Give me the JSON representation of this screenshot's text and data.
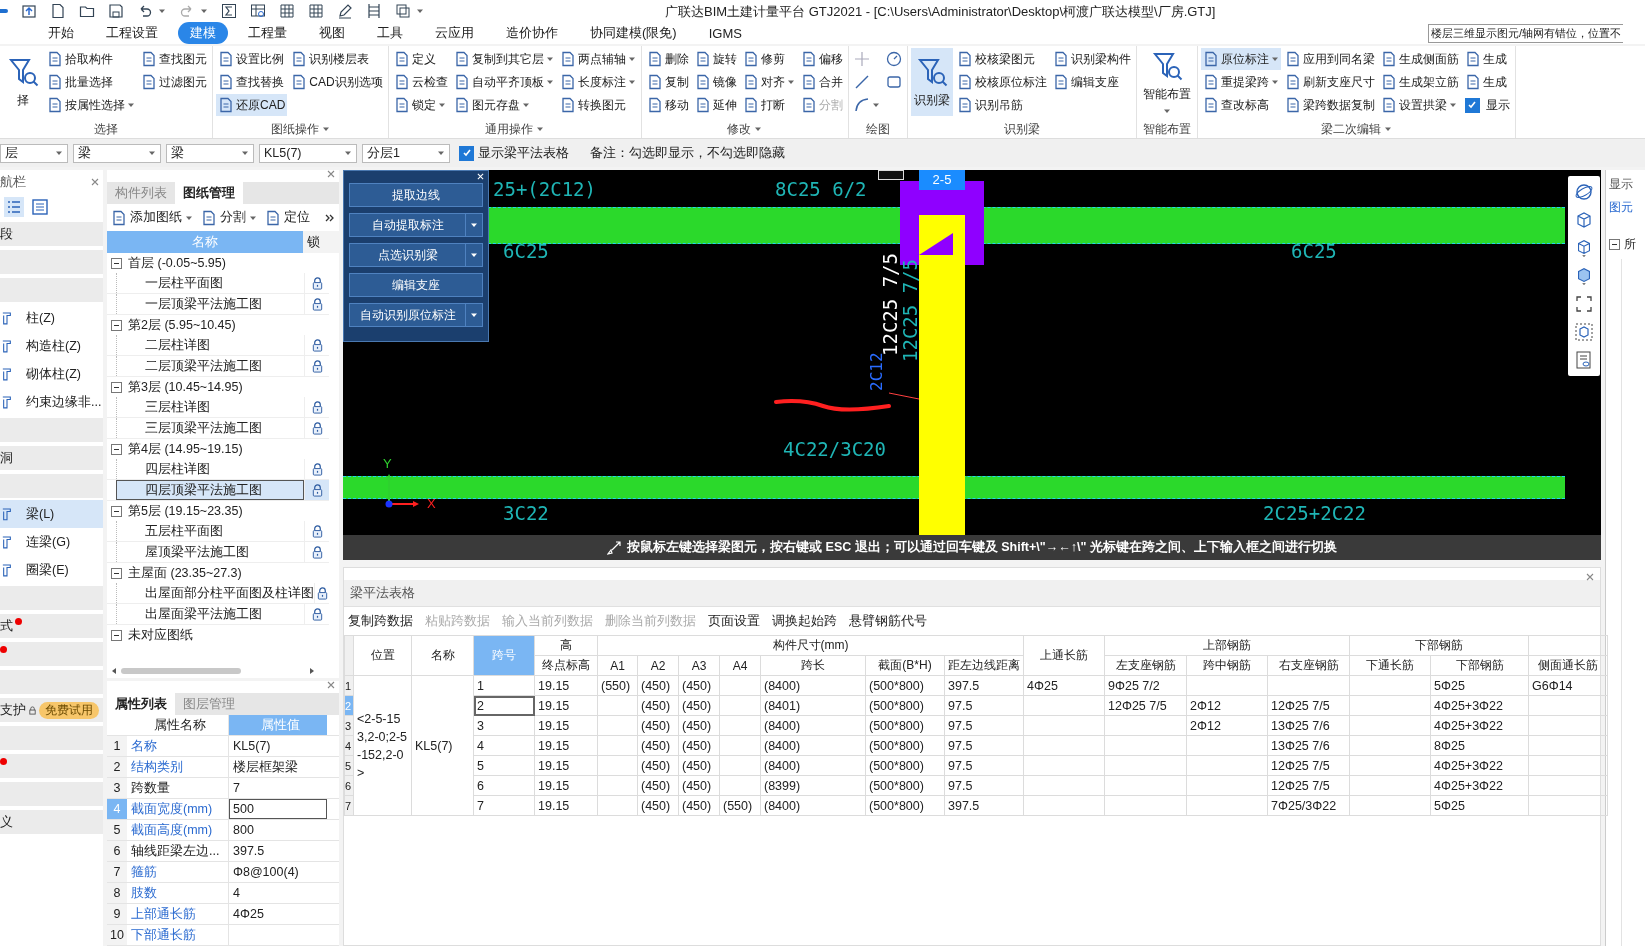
{
  "window": {
    "title": "广联达BIM土建计量平台 GTJ2021 - [C:\\Users\\Administrator\\Desktop\\柯渡广联达模型\\厂房.GTJ]"
  },
  "notice": "楼层三维显示图元/轴网有错位，位置不",
  "menu_tabs": [
    {
      "label": "开始",
      "selected": false
    },
    {
      "label": "工程设置",
      "selected": false
    },
    {
      "label": "建模",
      "selected": true
    },
    {
      "label": "工程量",
      "selected": false
    },
    {
      "label": "视图",
      "selected": false
    },
    {
      "label": "工具",
      "selected": false
    },
    {
      "label": "云应用",
      "selected": false
    },
    {
      "label": "造价协作",
      "selected": false
    },
    {
      "label": "协同建模(限免)",
      "selected": false
    },
    {
      "label": "IGMS",
      "selected": false
    }
  ],
  "ribbon_groups": [
    {
      "label": "选择",
      "menu": false,
      "columns": [
        [
          {
            "label": "择",
            "kind": "large",
            "selected": false,
            "disabled": false,
            "dropdown": false
          }
        ],
        [
          {
            "label": "拾取构件",
            "kind": "button",
            "selected": false,
            "disabled": false,
            "dropdown": false
          },
          {
            "label": "批量选择",
            "kind": "button",
            "selected": false,
            "disabled": false,
            "dropdown": false
          },
          {
            "label": "按属性选择",
            "kind": "button",
            "selected": false,
            "disabled": false,
            "dropdown": true
          }
        ],
        [
          {
            "label": "查找图元",
            "kind": "button",
            "selected": false,
            "disabled": false,
            "dropdown": false
          },
          {
            "label": "过滤图元",
            "kind": "button",
            "selected": false,
            "disabled": false,
            "dropdown": false
          }
        ]
      ]
    },
    {
      "label": "图纸操作",
      "menu": true,
      "columns": [
        [
          {
            "label": "设置比例",
            "kind": "button",
            "selected": false,
            "disabled": false,
            "dropdown": false
          },
          {
            "label": "查找替换",
            "kind": "button",
            "selected": false,
            "disabled": false,
            "dropdown": false
          },
          {
            "label": "还原CAD",
            "kind": "button",
            "selected": true,
            "disabled": false,
            "dropdown": false
          }
        ],
        [
          {
            "label": "识别楼层表",
            "kind": "button",
            "selected": false,
            "disabled": false,
            "dropdown": false
          },
          {
            "label": "CAD识别选项",
            "kind": "button",
            "selected": false,
            "disabled": false,
            "dropdown": false
          }
        ]
      ]
    },
    {
      "label": "通用操作",
      "menu": true,
      "columns": [
        [
          {
            "label": "定义",
            "kind": "button",
            "selected": false,
            "disabled": false,
            "dropdown": false
          },
          {
            "label": "云检查",
            "kind": "button",
            "selected": false,
            "disabled": false,
            "dropdown": false
          },
          {
            "label": "锁定",
            "kind": "button",
            "selected": false,
            "disabled": false,
            "dropdown": true
          }
        ],
        [
          {
            "label": "复制到其它层",
            "kind": "button",
            "selected": false,
            "disabled": false,
            "dropdown": true
          },
          {
            "label": "自动平齐顶板",
            "kind": "button",
            "selected": false,
            "disabled": false,
            "dropdown": true
          },
          {
            "label": "图元存盘",
            "kind": "button",
            "selected": false,
            "disabled": false,
            "dropdown": true
          }
        ],
        [
          {
            "label": "两点辅轴",
            "kind": "button",
            "selected": false,
            "disabled": false,
            "dropdown": true
          },
          {
            "label": "长度标注",
            "kind": "button",
            "selected": false,
            "disabled": false,
            "dropdown": true
          },
          {
            "label": "转换图元",
            "kind": "button",
            "selected": false,
            "disabled": false,
            "dropdown": false
          }
        ]
      ]
    },
    {
      "label": "修改",
      "menu": true,
      "columns": [
        [
          {
            "label": "删除",
            "kind": "button",
            "selected": false,
            "disabled": false,
            "dropdown": false
          },
          {
            "label": "复制",
            "kind": "button",
            "selected": false,
            "disabled": false,
            "dropdown": false
          },
          {
            "label": "移动",
            "kind": "button",
            "selected": false,
            "disabled": false,
            "dropdown": false
          }
        ],
        [
          {
            "label": "旋转",
            "kind": "button",
            "selected": false,
            "disabled": false,
            "dropdown": false
          },
          {
            "label": "镜像",
            "kind": "button",
            "selected": false,
            "disabled": false,
            "dropdown": false
          },
          {
            "label": "延伸",
            "kind": "button",
            "selected": false,
            "disabled": false,
            "dropdown": false
          }
        ],
        [
          {
            "label": "修剪",
            "kind": "button",
            "selected": false,
            "disabled": false,
            "dropdown": false
          },
          {
            "label": "对齐",
            "kind": "button",
            "selected": false,
            "disabled": false,
            "dropdown": true
          },
          {
            "label": "打断",
            "kind": "button",
            "selected": false,
            "disabled": false,
            "dropdown": false
          }
        ],
        [
          {
            "label": "偏移",
            "kind": "button",
            "selected": false,
            "disabled": false,
            "dropdown": false
          },
          {
            "label": "合并",
            "kind": "button",
            "selected": false,
            "disabled": false,
            "dropdown": false
          },
          {
            "label": "分割",
            "kind": "button",
            "selected": false,
            "disabled": true,
            "dropdown": false
          }
        ]
      ]
    },
    {
      "label": "绘图",
      "menu": false,
      "columns": [
        [
          {
            "kind": "icon",
            "selected": false,
            "disabled": false,
            "dropdown": false
          },
          {
            "kind": "icon",
            "selected": false,
            "disabled": false,
            "dropdown": false
          },
          {
            "kind": "icon",
            "selected": false,
            "disabled": false,
            "dropdown": true
          }
        ],
        [
          {
            "kind": "icon",
            "selected": false,
            "disabled": false,
            "dropdown": false
          },
          {
            "kind": "icon",
            "selected": false,
            "disabled": false,
            "dropdown": false
          }
        ]
      ]
    },
    {
      "label": "识别梁",
      "menu": false,
      "columns": [
        [
          {
            "label": "识别梁",
            "kind": "large",
            "selected": true,
            "disabled": false,
            "dropdown": false
          }
        ],
        [
          {
            "label": "校核梁图元",
            "kind": "button",
            "selected": false,
            "disabled": false,
            "dropdown": false
          },
          {
            "label": "校核原位标注",
            "kind": "button",
            "selected": false,
            "disabled": false,
            "dropdown": false
          },
          {
            "label": "识别吊筋",
            "kind": "button",
            "selected": false,
            "disabled": false,
            "dropdown": false
          }
        ],
        [
          {
            "label": "识别梁构件",
            "kind": "button",
            "selected": false,
            "disabled": false,
            "dropdown": false
          },
          {
            "label": "编辑支座",
            "kind": "button",
            "selected": false,
            "disabled": false,
            "dropdown": false
          }
        ]
      ]
    },
    {
      "label": "智能布置",
      "menu": false,
      "columns": [
        [
          {
            "label": "智能布置",
            "kind": "large",
            "selected": false,
            "disabled": false,
            "dropdown": true
          }
        ]
      ]
    },
    {
      "label": "梁二次编辑",
      "menu": true,
      "columns": [
        [
          {
            "label": "原位标注",
            "kind": "button",
            "selected": true,
            "disabled": false,
            "dropdown": true
          },
          {
            "label": "重提梁跨",
            "kind": "button",
            "selected": false,
            "disabled": false,
            "dropdown": true
          },
          {
            "label": "查改标高",
            "kind": "button",
            "selected": false,
            "disabled": false,
            "dropdown": false
          }
        ],
        [
          {
            "label": "应用到同名梁",
            "kind": "button",
            "selected": false,
            "disabled": false,
            "dropdown": false
          },
          {
            "label": "刷新支座尺寸",
            "kind": "button",
            "selected": false,
            "disabled": false,
            "dropdown": false
          },
          {
            "label": "梁跨数据复制",
            "kind": "button",
            "selected": false,
            "disabled": false,
            "dropdown": false
          }
        ],
        [
          {
            "label": "生成侧面筋",
            "kind": "button",
            "selected": false,
            "disabled": false,
            "dropdown": false
          },
          {
            "label": "生成架立筋",
            "kind": "button",
            "selected": false,
            "disabled": false,
            "dropdown": false
          },
          {
            "label": "设置拱梁",
            "kind": "button",
            "selected": false,
            "disabled": false,
            "dropdown": true
          }
        ],
        [
          {
            "label": "生成",
            "kind": "button",
            "selected": false,
            "disabled": false,
            "dropdown": false
          },
          {
            "label": "生成",
            "kind": "button",
            "selected": false,
            "disabled": false,
            "dropdown": false
          },
          {
            "label": "显示",
            "kind": "checkbox",
            "selected": false,
            "disabled": false,
            "dropdown": false,
            "checked": true
          }
        ]
      ]
    }
  ],
  "toolbar": {
    "selects": [
      "层",
      "梁",
      "梁",
      "KL5(7)",
      "分层1"
    ],
    "show_table": {
      "label": "显示梁平法表格",
      "checked": true
    },
    "note": "备注：勾选即显示，不勾选即隐藏"
  },
  "nav": {
    "title": "航栏",
    "items": [
      {
        "kind": "category",
        "label": "段"
      },
      {
        "kind": "category"
      },
      {
        "kind": "category"
      },
      {
        "kind": "item",
        "label": "柱(Z)",
        "selected": false
      },
      {
        "kind": "item",
        "label": "构造柱(Z)",
        "selected": false
      },
      {
        "kind": "item",
        "label": "砌体柱(Z)",
        "selected": false
      },
      {
        "kind": "item",
        "label": "约束边缘非...",
        "selected": false
      },
      {
        "kind": "category"
      },
      {
        "kind": "category",
        "label": "洞"
      },
      {
        "kind": "category"
      },
      {
        "kind": "item",
        "label": "梁(L)",
        "selected": true
      },
      {
        "kind": "item",
        "label": "连梁(G)",
        "selected": false
      },
      {
        "kind": "item",
        "label": "圈梁(E)",
        "selected": false
      },
      {
        "kind": "category"
      },
      {
        "kind": "category",
        "label": "式",
        "dot": true
      },
      {
        "kind": "category",
        "dot": true
      },
      {
        "kind": "category"
      },
      {
        "kind": "category",
        "label": "支护",
        "locked": true,
        "badge": "免费试用"
      },
      {
        "kind": "category"
      },
      {
        "kind": "category",
        "dot": true
      },
      {
        "kind": "category"
      },
      {
        "kind": "category",
        "label": "义"
      }
    ]
  },
  "drawing_panel": {
    "tabs": [
      {
        "label": "构件列表",
        "selected": false
      },
      {
        "label": "图纸管理",
        "selected": true
      }
    ],
    "actions": [
      {
        "label": "添加图纸",
        "dropdown": true
      },
      {
        "label": "分割",
        "dropdown": true
      },
      {
        "label": "定位",
        "dropdown": false
      }
    ],
    "columns": [
      "名称",
      "锁"
    ],
    "tree": [
      {
        "label": "首层 (-0.05~5.95)",
        "expanded": true,
        "children": [
          {
            "label": "一层柱平面图",
            "selected": false,
            "locked": true
          },
          {
            "label": "一层顶梁平法施工图",
            "selected": false,
            "locked": true
          }
        ]
      },
      {
        "label": "第2层 (5.95~10.45)",
        "expanded": true,
        "children": [
          {
            "label": "二层柱详图",
            "selected": false,
            "locked": true
          },
          {
            "label": "二层顶梁平法施工图",
            "selected": false,
            "locked": true
          }
        ]
      },
      {
        "label": "第3层 (10.45~14.95)",
        "expanded": true,
        "children": [
          {
            "label": "三层柱详图",
            "selected": false,
            "locked": true
          },
          {
            "label": "三层顶梁平法施工图",
            "selected": false,
            "locked": true
          }
        ]
      },
      {
        "label": "第4层 (14.95~19.15)",
        "expanded": true,
        "children": [
          {
            "label": "四层柱详图",
            "selected": false,
            "locked": true
          },
          {
            "label": "四层顶梁平法施工图",
            "selected": true,
            "locked": true
          }
        ]
      },
      {
        "label": "第5层 (19.15~23.35)",
        "expanded": true,
        "children": [
          {
            "label": "五层柱平面图",
            "selected": false,
            "locked": true
          },
          {
            "label": "屋顶梁平法施工图",
            "selected": false,
            "locked": true
          }
        ]
      },
      {
        "label": "主屋面 (23.35~27.3)",
        "expanded": true,
        "children": [
          {
            "label": "出屋面部分柱平面图及柱详图",
            "selected": false,
            "locked": true
          },
          {
            "label": "出屋面梁平法施工图",
            "selected": false,
            "locked": true
          }
        ]
      },
      {
        "label": "未对应图纸",
        "expanded": true
      }
    ]
  },
  "property_panel": {
    "tabs": [
      {
        "label": "属性列表",
        "selected": true
      },
      {
        "label": "图层管理",
        "selected": false
      }
    ],
    "columns": [
      "属性名称",
      "属性值"
    ],
    "rows": [
      {
        "index": "1",
        "name": "名称",
        "value": "KL5(7)",
        "link": true,
        "selected": false
      },
      {
        "index": "2",
        "name": "结构类别",
        "value": "楼层框架梁",
        "link": true,
        "selected": false
      },
      {
        "index": "3",
        "name": "跨数量",
        "value": "7",
        "link": false,
        "selected": false
      },
      {
        "index": "4",
        "name": "截面宽度(mm)",
        "value": "500",
        "link": true,
        "selected": true
      },
      {
        "index": "5",
        "name": "截面高度(mm)",
        "value": "800",
        "link": true,
        "selected": false
      },
      {
        "index": "6",
        "name": "轴线距梁左边...",
        "value": "397.5",
        "link": false,
        "selected": false
      },
      {
        "index": "7",
        "name": "箍筋",
        "value": "Φ8@100(4)",
        "link": true,
        "selected": false
      },
      {
        "index": "8",
        "name": "肢数",
        "value": "4",
        "link": true,
        "selected": false
      },
      {
        "index": "9",
        "name": "上部通长筋",
        "value": "4Φ25",
        "link": true,
        "selected": false
      },
      {
        "index": "10",
        "name": "下部通长筋",
        "link": true,
        "selected": false
      }
    ]
  },
  "recognize_panel": {
    "buttons": [
      {
        "label": "提取边线",
        "dropdown": false
      },
      {
        "label": "自动提取标注",
        "dropdown": true
      },
      {
        "label": "点选识别梁",
        "dropdown": true
      },
      {
        "label": "编辑支座",
        "dropdown": false
      },
      {
        "label": "自动识别原位标注",
        "dropdown": true
      }
    ]
  },
  "canvas": {
    "span_tag": "2-5",
    "labels": [
      {
        "kind": "annotation",
        "text": "25+(2C12)"
      },
      {
        "kind": "annotation",
        "text": "8C25 6/2"
      },
      {
        "kind": "annotation",
        "text": "6C25"
      },
      {
        "kind": "annotation",
        "text": "6C25"
      },
      {
        "kind": "vertical_white",
        "text": "12C25 7/5"
      },
      {
        "kind": "vertical",
        "text": "12C25 7/5"
      },
      {
        "kind": "vertical_blue",
        "text": "2C12"
      },
      {
        "kind": "annotation",
        "text": "4C22/3C20"
      },
      {
        "kind": "annotation",
        "text": "3C22"
      },
      {
        "kind": "annotation",
        "text": "2C25+2C22"
      }
    ],
    "axis": {
      "x": "X",
      "y": "Y"
    },
    "hint": "按鼠标左键选择梁图元，按右键或 ESC 退出；可以通过回车键及 Shift+\\\"→←↑\\\" 光标键在跨之间、上下输入框之间进行切换"
  },
  "beam_table": {
    "title": "梁平法表格",
    "actions": [
      {
        "label": "复制跨数据",
        "disabled": false
      },
      {
        "label": "粘贴跨数据",
        "disabled": true
      },
      {
        "label": "输入当前列数据",
        "disabled": true
      },
      {
        "label": "删除当前列数据",
        "disabled": true
      },
      {
        "label": "页面设置",
        "disabled": false
      },
      {
        "label": "调换起始跨",
        "disabled": false
      },
      {
        "label": "悬臂钢筋代号",
        "disabled": false
      }
    ],
    "header": [
      {
        "label": "位置",
        "selected": false
      },
      {
        "label": "名称",
        "selected": false
      },
      {
        "label": "跨号",
        "selected": true
      },
      {
        "label": "高",
        "selected": false,
        "columns": [
          "终点标高"
        ]
      },
      {
        "label": "构件尺寸(mm)",
        "selected": false,
        "columns": [
          "A1",
          "A2",
          "A3",
          "A4",
          "跨长",
          "截面(B*H)",
          "距左边线距离"
        ]
      },
      {
        "label": "上通长筋",
        "selected": false
      },
      {
        "label": "上部钢筋",
        "selected": false,
        "columns": [
          "左支座钢筋",
          "跨中钢筋",
          "右支座钢筋"
        ]
      },
      {
        "label": "下部钢筋",
        "selected": false,
        "columns": [
          "下通长筋",
          "下部钢筋"
        ]
      },
      {
        "selected": false,
        "columns": [
          "侧面通长筋"
        ]
      }
    ],
    "position": "<2-5-153,2-0;2-5-152,2-0>",
    "name": "KL5(7)",
    "rows": [
      {
        "number": "1",
        "selected": false,
        "cells": [
          "1",
          "19.15",
          "(550)",
          "(450)",
          "(450)",
          null,
          "(8400)",
          "(500*800)",
          "397.5",
          "4Φ25",
          "9Φ25 7/2",
          null,
          null,
          null,
          "5Φ25",
          "G6Φ14"
        ]
      },
      {
        "number": "2",
        "selected": true,
        "cells": [
          "2",
          "19.15",
          null,
          "(450)",
          "(450)",
          null,
          "(8401)",
          "(500*800)",
          "97.5",
          null,
          "12Φ25 7/5",
          "2Φ12",
          "12Φ25 7/5",
          null,
          "4Φ25+3Φ22",
          null
        ]
      },
      {
        "number": "3",
        "selected": false,
        "cells": [
          "3",
          "19.15",
          null,
          "(450)",
          "(450)",
          null,
          "(8400)",
          "(500*800)",
          "97.5",
          null,
          null,
          "2Φ12",
          "13Φ25 7/6",
          null,
          "4Φ25+3Φ22",
          null
        ]
      },
      {
        "number": "4",
        "selected": false,
        "cells": [
          "4",
          "19.15",
          null,
          "(450)",
          "(450)",
          null,
          "(8400)",
          "(500*800)",
          "97.5",
          null,
          null,
          null,
          "13Φ25 7/6",
          null,
          "8Φ25",
          null
        ]
      },
      {
        "number": "5",
        "selected": false,
        "cells": [
          "5",
          "19.15",
          null,
          "(450)",
          "(450)",
          null,
          "(8400)",
          "(500*800)",
          "97.5",
          null,
          null,
          null,
          "12Φ25 7/5",
          null,
          "4Φ25+3Φ22",
          null
        ]
      },
      {
        "number": "6",
        "selected": false,
        "cells": [
          "6",
          "19.15",
          null,
          "(450)",
          "(450)",
          null,
          "(8399)",
          "(500*800)",
          "97.5",
          null,
          null,
          null,
          "12Φ25 7/5",
          null,
          "4Φ25+3Φ22",
          null
        ]
      },
      {
        "number": "7",
        "selected": false,
        "cells": [
          "7",
          "19.15",
          null,
          "(450)",
          "(450)",
          "(550)",
          "(8400)",
          "(500*800)",
          "397.5",
          null,
          null,
          null,
          "7Φ25/3Φ22",
          null,
          "5Φ25",
          null
        ]
      }
    ]
  },
  "right_panel": {
    "title": "显示",
    "tab": "图元",
    "tree_item": "所"
  }
}
